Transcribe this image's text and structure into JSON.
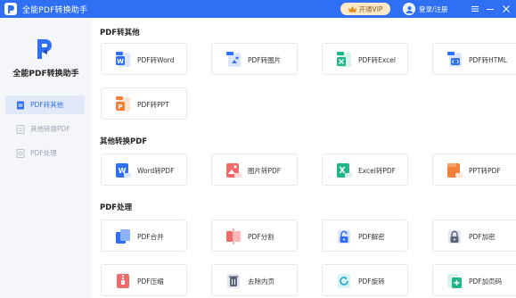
{
  "app": {
    "title": "全能PDF转换助手"
  },
  "titlebar": {
    "vip_label": "开通VIP",
    "login_label": "登录/注册"
  },
  "sidebar": {
    "title": "全能PDF转换助手",
    "items": [
      {
        "label": "PDF转其他",
        "active": true
      },
      {
        "label": "其他转换PDF",
        "active": false
      },
      {
        "label": "PDF处理",
        "active": false
      }
    ]
  },
  "sections": [
    {
      "title": "PDF转其他",
      "cards": [
        {
          "label": "PDF转Word",
          "icon": "pdf-to-word-icon"
        },
        {
          "label": "PDF转图片",
          "icon": "pdf-to-image-icon"
        },
        {
          "label": "PDF转Excel",
          "icon": "pdf-to-excel-icon"
        },
        {
          "label": "PDF转HTML",
          "icon": "pdf-to-html-icon"
        },
        {
          "label": "PDF转PPT",
          "icon": "pdf-to-ppt-icon"
        }
      ]
    },
    {
      "title": "其他转换PDF",
      "cards": [
        {
          "label": "Word转PDF",
          "icon": "word-to-pdf-icon"
        },
        {
          "label": "图片转PDF",
          "icon": "image-to-pdf-icon"
        },
        {
          "label": "Excel转PDF",
          "icon": "excel-to-pdf-icon"
        },
        {
          "label": "PPT转PDF",
          "icon": "ppt-to-pdf-icon"
        }
      ]
    },
    {
      "title": "PDF处理",
      "cards": [
        {
          "label": "PDF合并",
          "icon": "pdf-merge-icon"
        },
        {
          "label": "PDF分割",
          "icon": "pdf-split-icon"
        },
        {
          "label": "PDF解密",
          "icon": "pdf-decrypt-icon"
        },
        {
          "label": "PDF加密",
          "icon": "pdf-encrypt-icon"
        },
        {
          "label": "PDF压缩",
          "icon": "pdf-compress-icon"
        },
        {
          "label": "去除内页",
          "icon": "remove-pages-icon"
        },
        {
          "label": "PDF旋转",
          "icon": "pdf-rotate-icon"
        },
        {
          "label": "PDF加页码",
          "icon": "pdf-page-number-icon"
        }
      ]
    }
  ],
  "colors": {
    "brand": "#2f6ff3",
    "word": "#2f6ff3",
    "excel": "#1fb68a",
    "ppt": "#f2803a",
    "image": "#f06a6a",
    "sidebar_bg": "#f4f6f9"
  }
}
